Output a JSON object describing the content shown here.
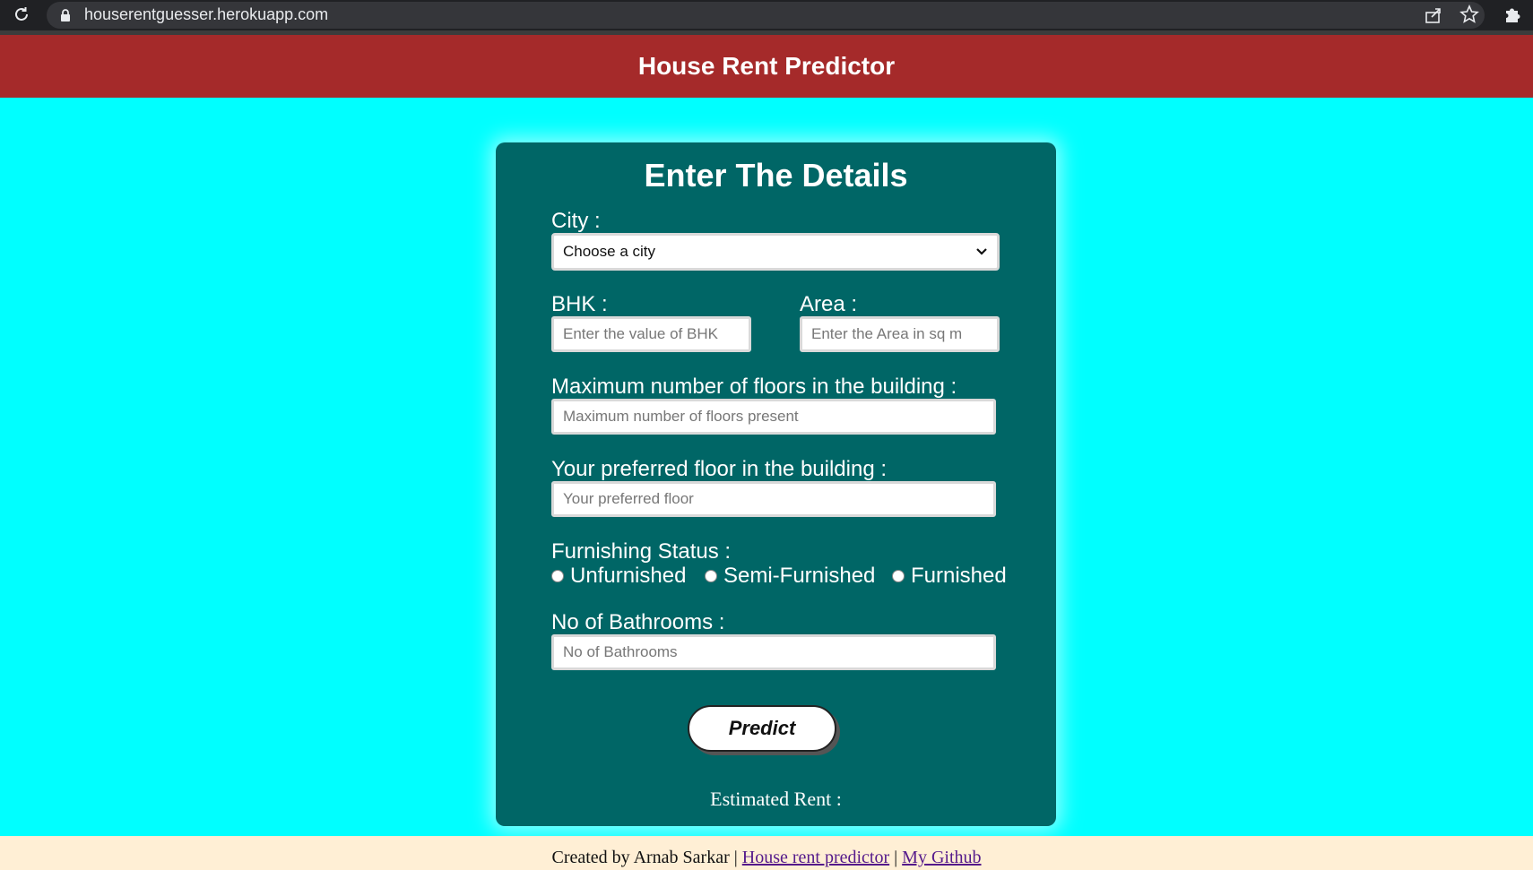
{
  "browser": {
    "url": "houserentguesser.herokuapp.com",
    "icons": [
      "reload-icon",
      "lock-icon",
      "share-icon",
      "star-icon",
      "extensions-icon"
    ]
  },
  "header": {
    "title": "House Rent Predictor"
  },
  "form": {
    "title": "Enter The Details",
    "city": {
      "label": "City :",
      "selected": "Choose a city"
    },
    "bhk": {
      "label": "BHK :",
      "placeholder": "Enter the value of BHK"
    },
    "area": {
      "label": "Area :",
      "placeholder": "Enter the Area in sq m"
    },
    "max_floors": {
      "label": "Maximum number of floors in the building :",
      "placeholder": "Maximum number of floors present"
    },
    "preferred_floor": {
      "label": "Your preferred floor in the building :",
      "placeholder": "Your preferred floor"
    },
    "furnishing": {
      "label": "Furnishing Status :",
      "options": [
        "Unfurnished",
        "Semi-Furnished",
        "Furnished"
      ]
    },
    "bathrooms": {
      "label": "No of Bathrooms :",
      "placeholder": "No of Bathrooms"
    },
    "predict_label": "Predict",
    "estimate_label": "Estimated Rent :"
  },
  "footer": {
    "prefix": "Created by Arnab Sarkar",
    "separator": "|",
    "link1": "House rent predictor",
    "link2": "My Github"
  },
  "colors": {
    "header": "#a52a2a",
    "page_bg": "#00ffff",
    "card": "#006666",
    "footer_bg": "#ffefd5"
  }
}
